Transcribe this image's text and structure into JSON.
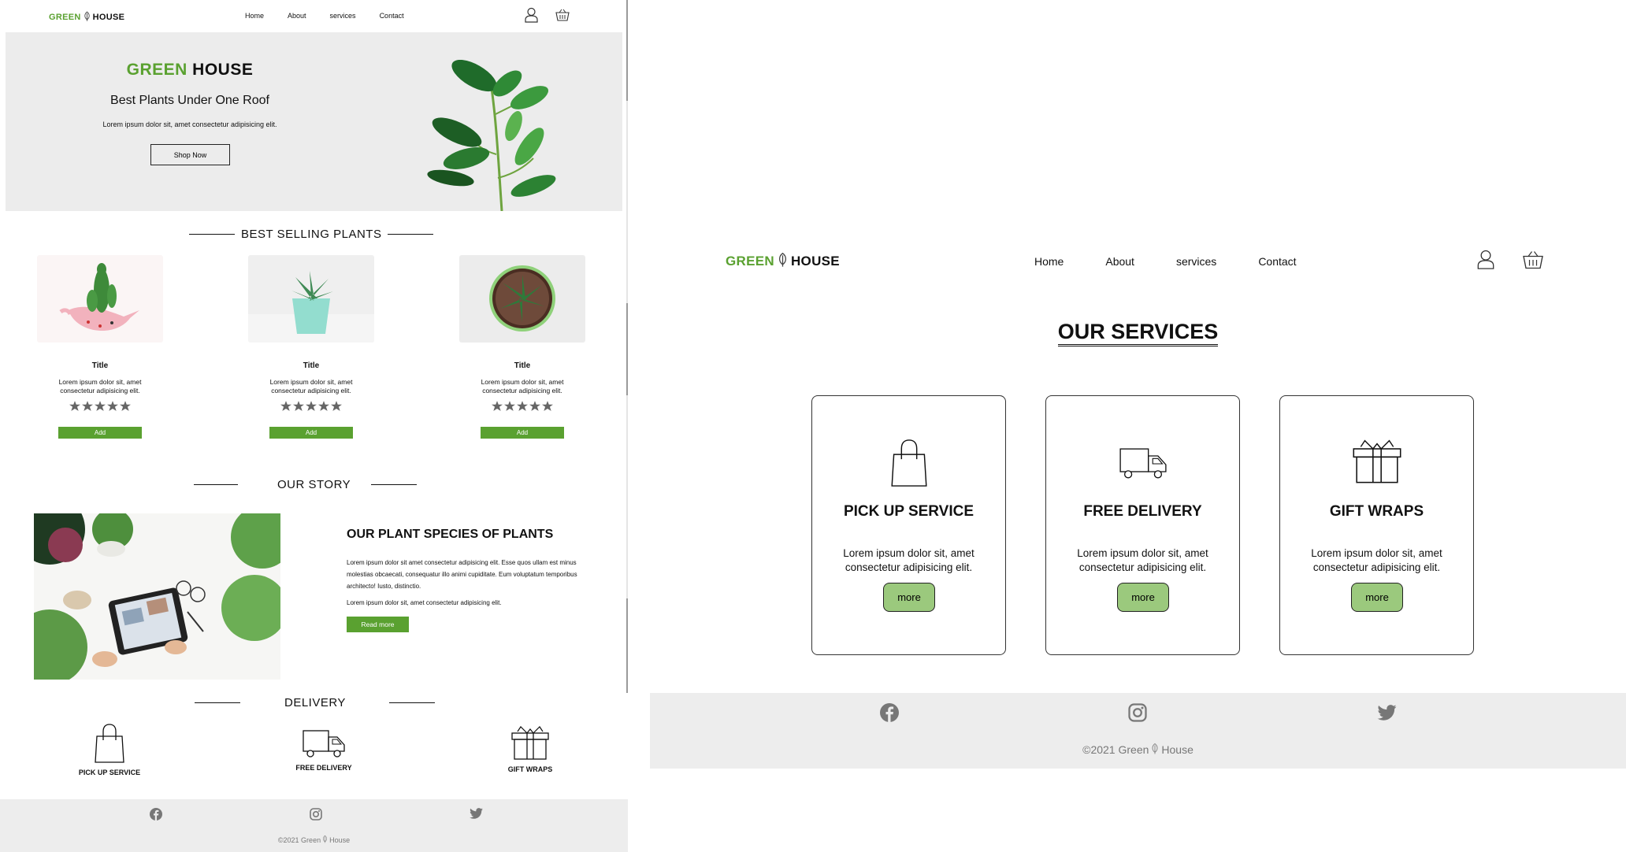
{
  "brand": {
    "green": "GREEN",
    "house": "HOUSE",
    "green_color": "#5aa130"
  },
  "nav": {
    "items": [
      "Home",
      "About",
      "services",
      "Contact"
    ]
  },
  "hero": {
    "title_green": "GREEN",
    "title_house": "HOUSE",
    "subtitle": "Best Plants Under One Roof",
    "text": "Lorem ipsum dolor sit, amet consectetur adipisicing elit.",
    "button": "Shop Now"
  },
  "best_selling": {
    "heading": "BEST SELLING PLANTS",
    "products": [
      {
        "title": "Title",
        "desc": "Lorem ipsum dolor sit, amet consectetur adipisicing elit.",
        "rating": 5,
        "button": "Add"
      },
      {
        "title": "Title",
        "desc": "Lorem ipsum dolor sit, amet consectetur adipisicing elit.",
        "rating": 5,
        "button": "Add"
      },
      {
        "title": "Title",
        "desc": "Lorem ipsum dolor sit, amet consectetur adipisicing elit.",
        "rating": 5,
        "button": "Add"
      }
    ]
  },
  "story": {
    "heading": "OUR STORY",
    "title": "OUR PLANT SPECIES OF PLANTS",
    "p1": "Lorem ipsum dolor sit amet consectetur adipisicing elit. Esse quos ullam est minus molestias obcaecati, consequatur illo animi cupiditate. Eum voluptatum temporibus architecto! Iusto, distinctio.",
    "p2": "Lorem ipsum dolor sit, amet consectetur adipisicing elit.",
    "button": "Read more"
  },
  "delivery": {
    "heading": "DELIVERY",
    "items": [
      {
        "label": "PICK UP SERVICE",
        "icon": "shopping-bag-icon"
      },
      {
        "label": "FREE DELIVERY",
        "icon": "truck-icon"
      },
      {
        "label": "GIFT WRAPS",
        "icon": "gift-icon"
      }
    ]
  },
  "services": {
    "heading": "OUR SERVICES",
    "cards": [
      {
        "title": "PICK UP SERVICE",
        "desc": "Lorem ipsum dolor sit, amet consectetur adipisicing elit.",
        "button": "more",
        "icon": "shopping-bag-icon"
      },
      {
        "title": "FREE DELIVERY",
        "desc": "Lorem ipsum dolor sit, amet consectetur adipisicing elit.",
        "button": "more",
        "icon": "truck-icon"
      },
      {
        "title": "GIFT WRAPS",
        "desc": "Lorem ipsum dolor sit, amet consectetur adipisicing elit.",
        "button": "more",
        "icon": "gift-icon"
      }
    ],
    "button_color": "#9bc97d"
  },
  "footer": {
    "social": [
      "facebook-icon",
      "instagram-icon",
      "twitter-icon"
    ],
    "copyright_prefix": "©2021 Green",
    "copyright_suffix": "House"
  }
}
